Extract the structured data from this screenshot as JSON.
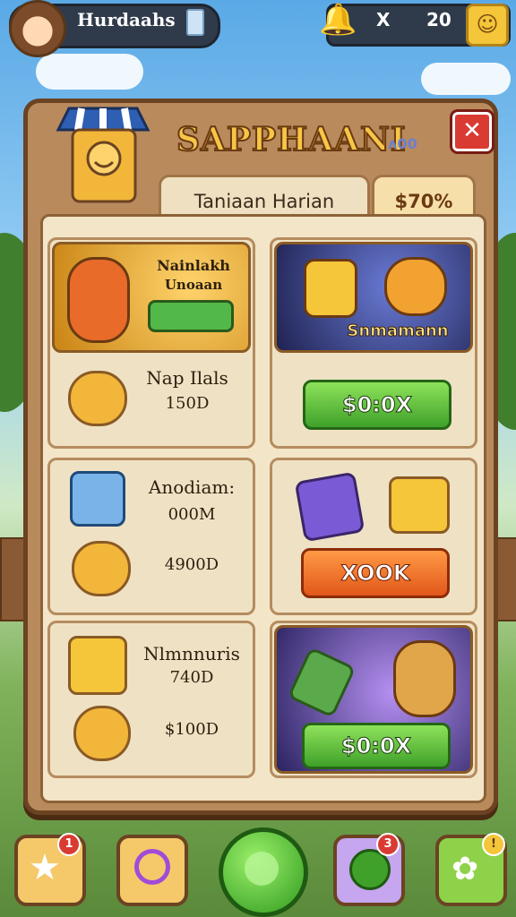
{
  "player": {
    "name": "Hurdaahs"
  },
  "currency": {
    "x_label": "X",
    "amount": "20"
  },
  "panel": {
    "title": "SAPPHAANI",
    "title_decor": "ʌ00",
    "close_label": "✕",
    "tab_daily": "Taniaan Harian",
    "tab_discount": "$70%"
  },
  "offers": [
    {
      "featured_line1": "Nainlakh",
      "featured_line2": "Unoaan"
    },
    {
      "featured_text": "Snmamann",
      "price": "$0:0X"
    },
    {
      "name": "Nap Ilals",
      "amount": "150D"
    },
    {
      "name": "Anodiam:",
      "amount1": "000M",
      "amount2": "4900D"
    },
    {
      "price": "XOOK"
    },
    {
      "name": "Nlmnnuris",
      "amount1": "740D",
      "amount2": "$100D"
    },
    {
      "price": "$0:0X"
    }
  ],
  "nav": {
    "badge_left": "1",
    "badge_chat": "3",
    "badge_right": "!"
  },
  "colors": {
    "accent_green": "#3fa12a",
    "accent_orange": "#e1571a",
    "panel_wood": "#b98a5c",
    "title_gold": "#f7c646"
  }
}
